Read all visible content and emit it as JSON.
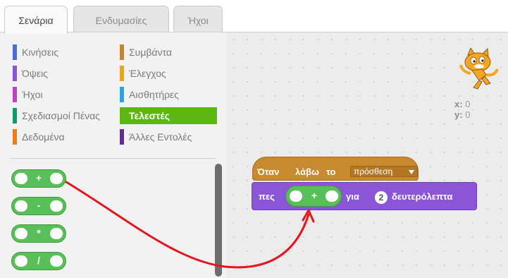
{
  "tabs": [
    {
      "label": "Σενάρια",
      "active": true
    },
    {
      "label": "Ενδυμασίες",
      "active": false
    },
    {
      "label": "Ήχοι",
      "active": false
    }
  ],
  "categories": {
    "left": [
      {
        "label": "Κινήσεις",
        "color": "#4a6cd4"
      },
      {
        "label": "Όψεις",
        "color": "#8a55d7"
      },
      {
        "label": "Ήχοι",
        "color": "#bb42c3"
      },
      {
        "label": "Σχεδιασμοί Πένας",
        "color": "#0e9a6c"
      },
      {
        "label": "Δεδομένα",
        "color": "#ee7d16"
      }
    ],
    "right": [
      {
        "label": "Συμβάντα",
        "color": "#c88330"
      },
      {
        "label": "Έλεγχος",
        "color": "#e1a91a"
      },
      {
        "label": "Αισθητήρες",
        "color": "#2ca5e2"
      },
      {
        "label": "Τελεστές",
        "color": "#5cb712",
        "selected": true
      },
      {
        "label": "Άλλες Εντολές",
        "color": "#632d99"
      }
    ]
  },
  "palette_blocks": [
    {
      "operator": "+"
    },
    {
      "operator": "-"
    },
    {
      "operator": "*"
    },
    {
      "operator": "/"
    }
  ],
  "sprite": {
    "x_label": "x:",
    "x_value": "0",
    "y_label": "y:",
    "y_value": "0"
  },
  "script": {
    "hat": {
      "word1": "Όταν",
      "word2": "λάβω",
      "word3": "το",
      "message": "πρόσθεση"
    },
    "say": {
      "word1": "πες",
      "operator": "+",
      "word2": "για",
      "seconds": "2",
      "word3": "δευτερόλεπτα"
    }
  },
  "colors": {
    "operators": "#59c059",
    "events": "#c88a2f",
    "looks": "#8a55d7",
    "arrow": "#e8141b"
  }
}
